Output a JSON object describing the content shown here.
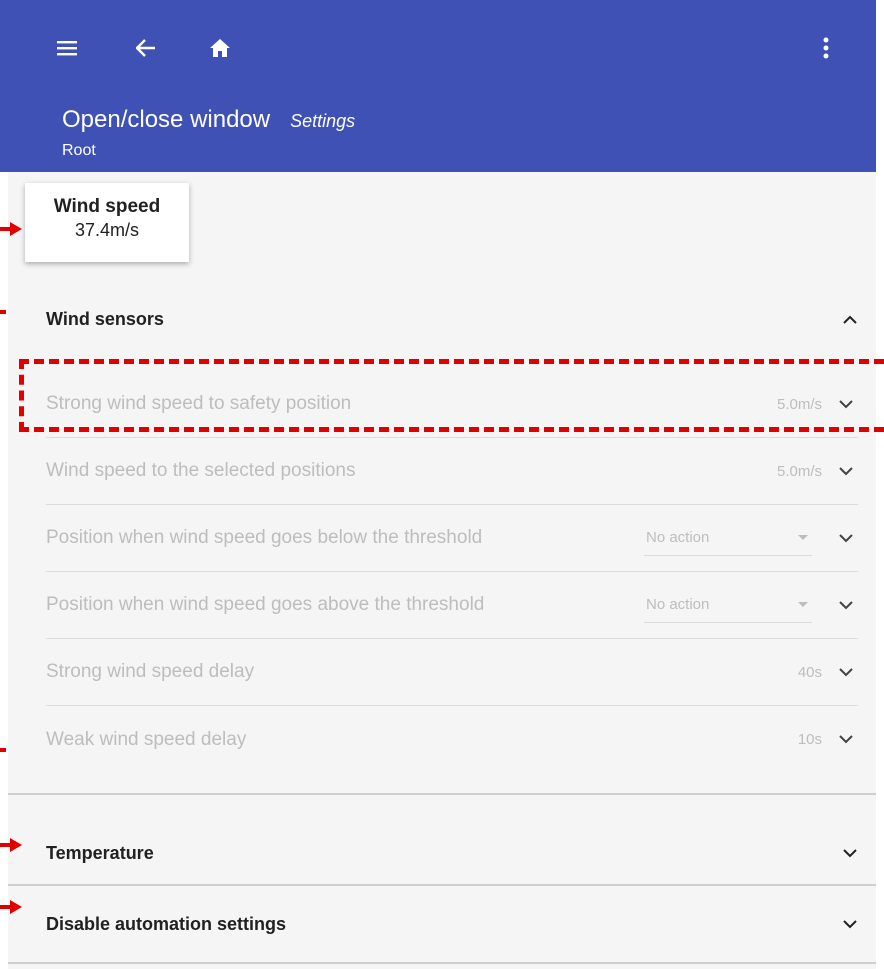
{
  "header": {
    "title": "Open/close window",
    "subtitle": "Settings",
    "breadcrumb": "Root"
  },
  "icons": {
    "menu": "menu-icon",
    "back": "arrow-left-icon",
    "home": "home-icon",
    "more": "more-vertical-icon"
  },
  "tooltip": {
    "title": "Wind speed",
    "value": "37.4m/s"
  },
  "wind_sensors": {
    "title": "Wind sensors",
    "rows": [
      {
        "label": "Strong wind speed to safety position",
        "value": "5.0m/s"
      },
      {
        "label": "Wind speed to the selected positions",
        "value": "5.0m/s"
      },
      {
        "label": "Position when wind speed goes below the threshold",
        "select": "No action"
      },
      {
        "label": "Position when wind speed goes above the threshold",
        "select": "No action"
      },
      {
        "label": "Strong wind speed delay",
        "value": "40s"
      },
      {
        "label": "Weak wind speed delay",
        "value": "10s"
      }
    ]
  },
  "temperature": {
    "title": "Temperature"
  },
  "disable_automation": {
    "title": "Disable automation settings"
  },
  "colors": {
    "appbar": "#3f51b5",
    "annotation": "#e00000",
    "disabled_text": "#bdbdbd"
  }
}
